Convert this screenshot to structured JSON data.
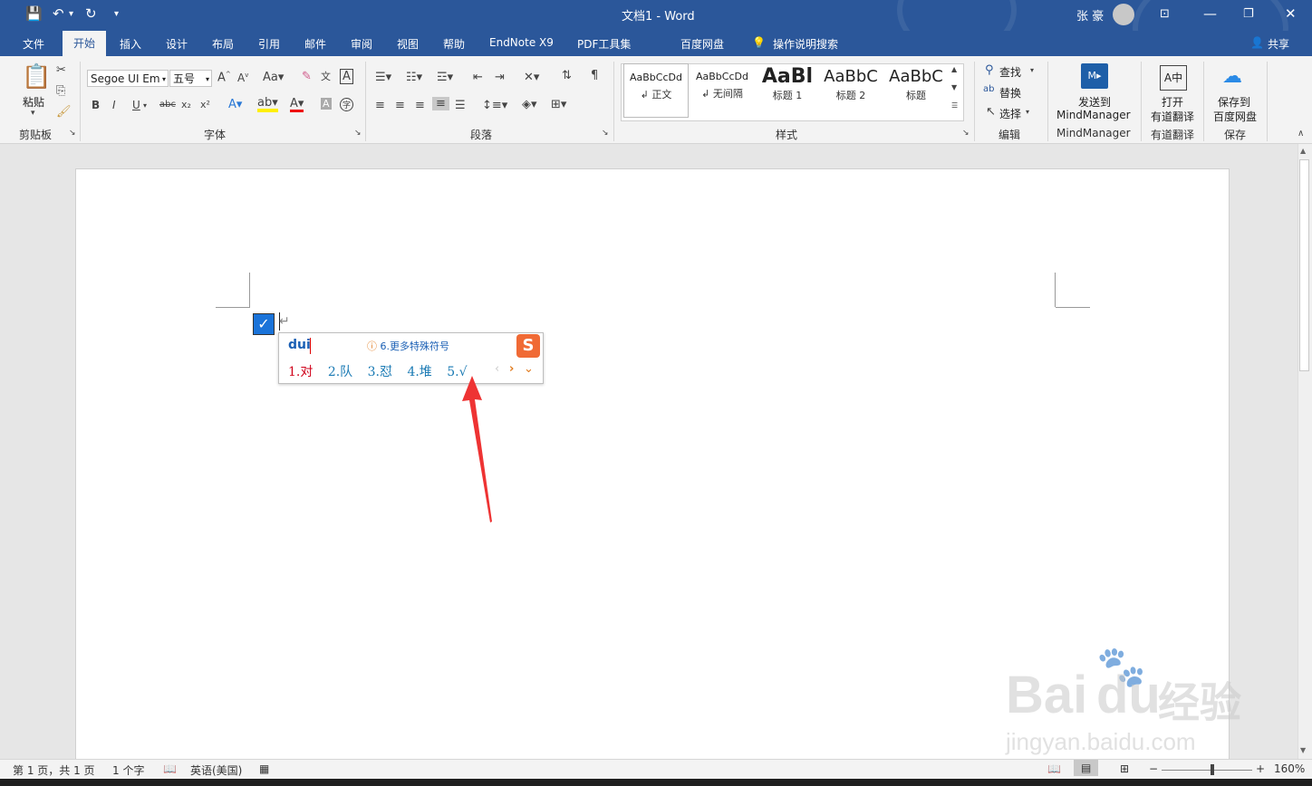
{
  "window": {
    "title": "文档1 - Word",
    "user": "张 豪",
    "share_label": "共享"
  },
  "tabs": [
    "文件",
    "开始",
    "插入",
    "设计",
    "布局",
    "引用",
    "邮件",
    "审阅",
    "视图",
    "帮助",
    "EndNote X9",
    "PDF工具集",
    "百度网盘",
    "操作说明搜索"
  ],
  "active_tab": "开始",
  "ribbon": {
    "clipboard": {
      "paste": "粘贴",
      "label": "剪贴板"
    },
    "font": {
      "name": "Segoe UI Em",
      "size": "五号",
      "label": "字体",
      "case": "Aa",
      "bold": "B",
      "italic": "I",
      "underline": "U",
      "strike": "abc",
      "sub": "x₂",
      "sup": "x²"
    },
    "paragraph": {
      "label": "段落"
    },
    "styles": {
      "label": "样式",
      "items": [
        {
          "preview": "AaBbCcDd",
          "name": "↲ 正文"
        },
        {
          "preview": "AaBbCcDd",
          "name": "↲ 无间隔"
        },
        {
          "preview": "AaBl",
          "name": "标题 1"
        },
        {
          "preview": "AaBbC",
          "name": "标题 2"
        },
        {
          "preview": "AaBbC",
          "name": "标题"
        }
      ]
    },
    "editing": {
      "find": "查找",
      "replace": "替换",
      "select": "选择",
      "label": "编辑"
    },
    "mindmanager": {
      "line1": "发送到",
      "line2": "MindManager",
      "label": "MindManager"
    },
    "youdao": {
      "line1": "打开",
      "line2": "有道翻译",
      "label": "有道翻译"
    },
    "baidu": {
      "line1": "保存到",
      "line2": "百度网盘",
      "label": "保存"
    }
  },
  "ime": {
    "input": "dui",
    "tip": "6.更多特殊符号",
    "candidates": [
      "1.对",
      "2.队",
      "3.怼",
      "4.堆",
      "5.√"
    ],
    "logo": "S"
  },
  "status": {
    "page": "第 1 页，共 1 页",
    "words": "1 个字",
    "lang": "英语(美国)",
    "zoom": "160%"
  },
  "watermark": {
    "text1": "Bai",
    "text2": "du",
    "text3": "经验",
    "url": "jingyan.baidu.com"
  },
  "colors": {
    "accent": "#2b579a",
    "checkbox": "#1a73d9",
    "arrow": "#ee3333",
    "sogou": "#f06a35"
  }
}
